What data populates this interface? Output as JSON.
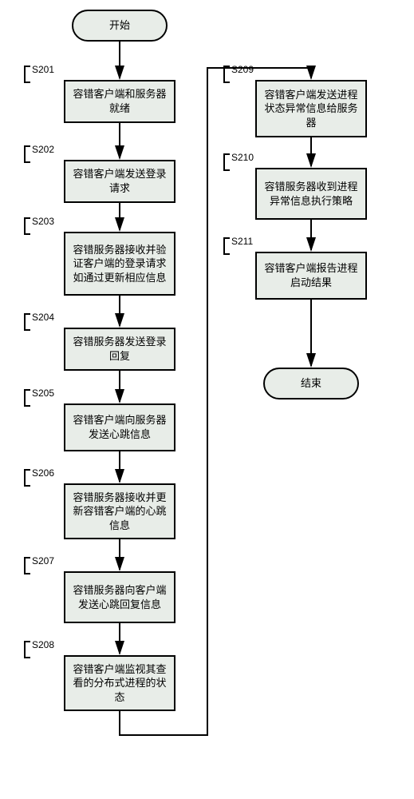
{
  "terminals": {
    "start": "开始",
    "end": "结束"
  },
  "steps": {
    "s201": {
      "label": "S201",
      "text": "容错客户端和服务器就绪"
    },
    "s202": {
      "label": "S202",
      "text": "容错客户端发送登录请求"
    },
    "s203": {
      "label": "S203",
      "text": "容错服务器接收并验证客户端的登录请求如通过更新相应信息"
    },
    "s204": {
      "label": "S204",
      "text": "容错服务器发送登录回复"
    },
    "s205": {
      "label": "S205",
      "text": "容错客户端向服务器发送心跳信息"
    },
    "s206": {
      "label": "S206",
      "text": "容错服务器接收并更新容错客户端的心跳信息"
    },
    "s207": {
      "label": "S207",
      "text": "容错服务器向客户端发送心跳回复信息"
    },
    "s208": {
      "label": "S208",
      "text": "容错客户端监视其查看的分布式进程的状态"
    },
    "s209": {
      "label": "S209",
      "text": "容错客户端发送进程状态异常信息给服务器"
    },
    "s210": {
      "label": "S210",
      "text": "容错服务器收到进程异常信息执行策略"
    },
    "s211": {
      "label": "S211",
      "text": "容错客户端报告进程启动结果"
    }
  },
  "chart_data": {
    "type": "flowchart",
    "nodes": [
      {
        "id": "start",
        "kind": "terminal",
        "label": "开始"
      },
      {
        "id": "S201",
        "kind": "process",
        "label": "容错客户端和服务器就绪"
      },
      {
        "id": "S202",
        "kind": "process",
        "label": "容错客户端发送登录请求"
      },
      {
        "id": "S203",
        "kind": "process",
        "label": "容错服务器接收并验证客户端的登录请求如通过更新相应信息"
      },
      {
        "id": "S204",
        "kind": "process",
        "label": "容错服务器发送登录回复"
      },
      {
        "id": "S205",
        "kind": "process",
        "label": "容错客户端向服务器发送心跳信息"
      },
      {
        "id": "S206",
        "kind": "process",
        "label": "容错服务器接收并更新容错客户端的心跳信息"
      },
      {
        "id": "S207",
        "kind": "process",
        "label": "容错服务器向客户端发送心跳回复信息"
      },
      {
        "id": "S208",
        "kind": "process",
        "label": "容错客户端监视其查看的分布式进程的状态"
      },
      {
        "id": "S209",
        "kind": "process",
        "label": "容错客户端发送进程状态异常信息给服务器"
      },
      {
        "id": "S210",
        "kind": "process",
        "label": "容错服务器收到进程异常信息执行策略"
      },
      {
        "id": "S211",
        "kind": "process",
        "label": "容错客户端报告进程启动结果"
      },
      {
        "id": "end",
        "kind": "terminal",
        "label": "结束"
      }
    ],
    "edges": [
      {
        "from": "start",
        "to": "S201"
      },
      {
        "from": "S201",
        "to": "S202"
      },
      {
        "from": "S202",
        "to": "S203"
      },
      {
        "from": "S203",
        "to": "S204"
      },
      {
        "from": "S204",
        "to": "S205"
      },
      {
        "from": "S205",
        "to": "S206"
      },
      {
        "from": "S206",
        "to": "S207"
      },
      {
        "from": "S207",
        "to": "S208"
      },
      {
        "from": "S208",
        "to": "S209"
      },
      {
        "from": "S209",
        "to": "S210"
      },
      {
        "from": "S210",
        "to": "S211"
      },
      {
        "from": "S211",
        "to": "end"
      }
    ]
  }
}
